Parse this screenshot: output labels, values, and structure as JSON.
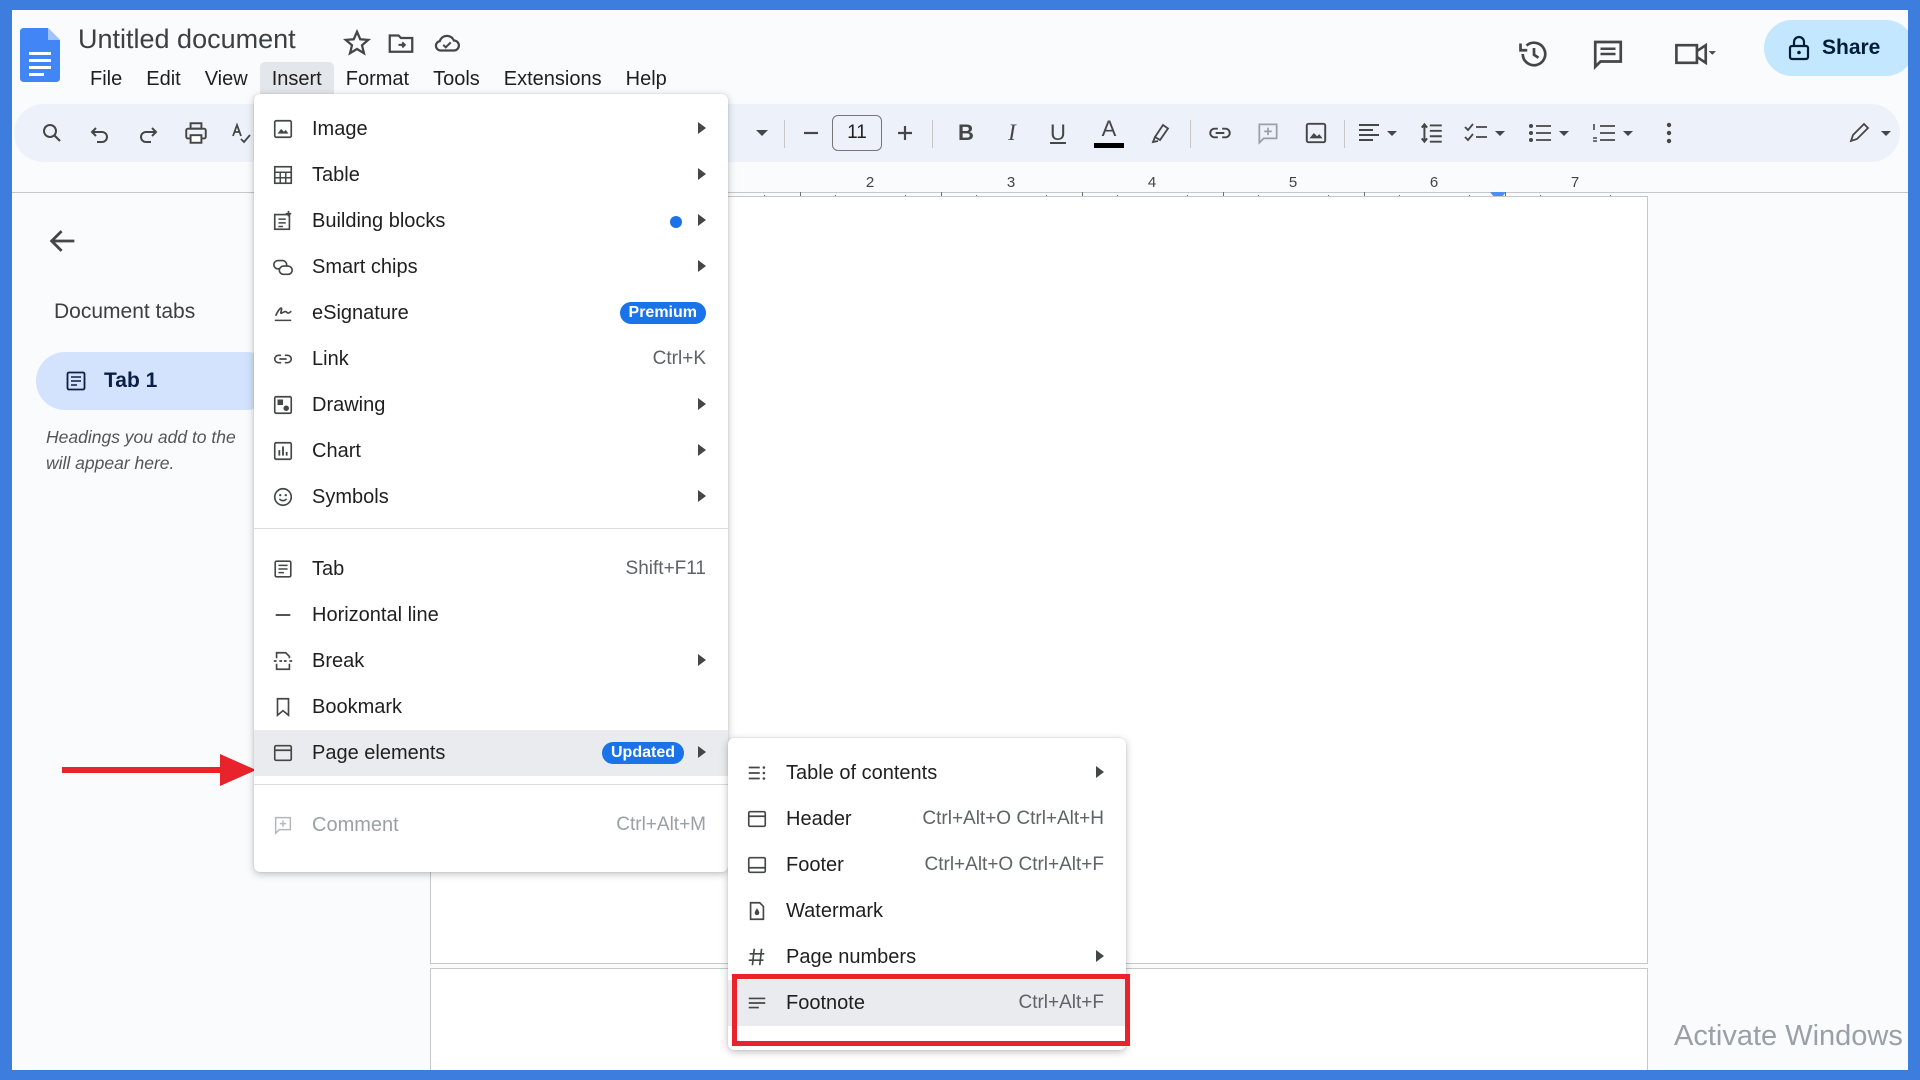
{
  "document": {
    "title": "Untitled document"
  },
  "menubar": [
    "File",
    "Edit",
    "View",
    "Insert",
    "Format",
    "Tools",
    "Extensions",
    "Help"
  ],
  "menubar_active": "Insert",
  "header_right": {
    "share_label": "Share",
    "icons": [
      "history-icon",
      "comments-icon",
      "meet-icon",
      "lock-icon"
    ]
  },
  "toolbar": {
    "font_size": "11",
    "icons": [
      "search-icon",
      "undo-icon",
      "redo-icon",
      "print-icon",
      "spellcheck-icon",
      "decrease-font-icon",
      "increase-font-icon",
      "bold-icon",
      "italic-icon",
      "underline-icon",
      "text-color-icon",
      "highlight-icon",
      "link-icon",
      "add-comment-icon",
      "insert-image-icon",
      "align-icon",
      "line-spacing-icon",
      "checklist-icon",
      "bulleted-list-icon",
      "numbered-list-icon",
      "more-icon",
      "editing-mode-icon"
    ]
  },
  "ruler": {
    "numbers": [
      "2",
      "3",
      "4",
      "5",
      "6",
      "7"
    ]
  },
  "sidebar": {
    "heading": "Document tabs",
    "tab_label": "Tab 1",
    "hint_line1": "Headings you add to the",
    "hint_line2": "will appear here."
  },
  "insert_menu": {
    "items": [
      {
        "label": "Image",
        "submenu": true,
        "icon": "image-icon"
      },
      {
        "label": "Table",
        "submenu": true,
        "icon": "table-icon"
      },
      {
        "label": "Building blocks",
        "submenu": true,
        "dot": true,
        "icon": "building-blocks-icon"
      },
      {
        "label": "Smart chips",
        "submenu": true,
        "icon": "smart-chips-icon"
      },
      {
        "label": "eSignature",
        "badge": "Premium",
        "icon": "esignature-icon"
      },
      {
        "label": "Link",
        "shortcut": "Ctrl+K",
        "icon": "link-icon"
      },
      {
        "label": "Drawing",
        "submenu": true,
        "icon": "drawing-icon"
      },
      {
        "label": "Chart",
        "submenu": true,
        "icon": "chart-icon"
      },
      {
        "label": "Symbols",
        "submenu": true,
        "icon": "symbols-icon"
      },
      {
        "label": "Tab",
        "shortcut": "Shift+F11",
        "icon": "tab-icon"
      },
      {
        "label": "Horizontal line",
        "icon": "horizontal-line-icon"
      },
      {
        "label": "Break",
        "submenu": true,
        "icon": "break-icon"
      },
      {
        "label": "Bookmark",
        "icon": "bookmark-icon"
      },
      {
        "label": "Page elements",
        "badge": "Updated",
        "submenu": true,
        "icon": "page-elements-icon",
        "highlighted": true
      },
      {
        "label": "Comment",
        "shortcut": "Ctrl+Alt+M",
        "icon": "comment-icon",
        "disabled": true
      }
    ]
  },
  "page_elements_menu": {
    "items": [
      {
        "label": "Table of contents",
        "submenu": true,
        "icon": "table-of-contents-icon"
      },
      {
        "label": "Header",
        "shortcut": "Ctrl+Alt+O Ctrl+Alt+H",
        "icon": "header-icon"
      },
      {
        "label": "Footer",
        "shortcut": "Ctrl+Alt+O Ctrl+Alt+F",
        "icon": "footer-icon"
      },
      {
        "label": "Watermark",
        "icon": "watermark-icon"
      },
      {
        "label": "Page numbers",
        "submenu": true,
        "icon": "page-numbers-icon"
      },
      {
        "label": "Footnote",
        "shortcut": "Ctrl+Alt+F",
        "icon": "footnote-icon",
        "highlighted": true
      }
    ]
  },
  "watermark_text": "Activate Windows",
  "colors": {
    "frame_border": "#3c7ddd",
    "accent_blue": "#1a73e8",
    "share_bg": "#c2e7ff",
    "annotation_red": "#e8232b"
  }
}
